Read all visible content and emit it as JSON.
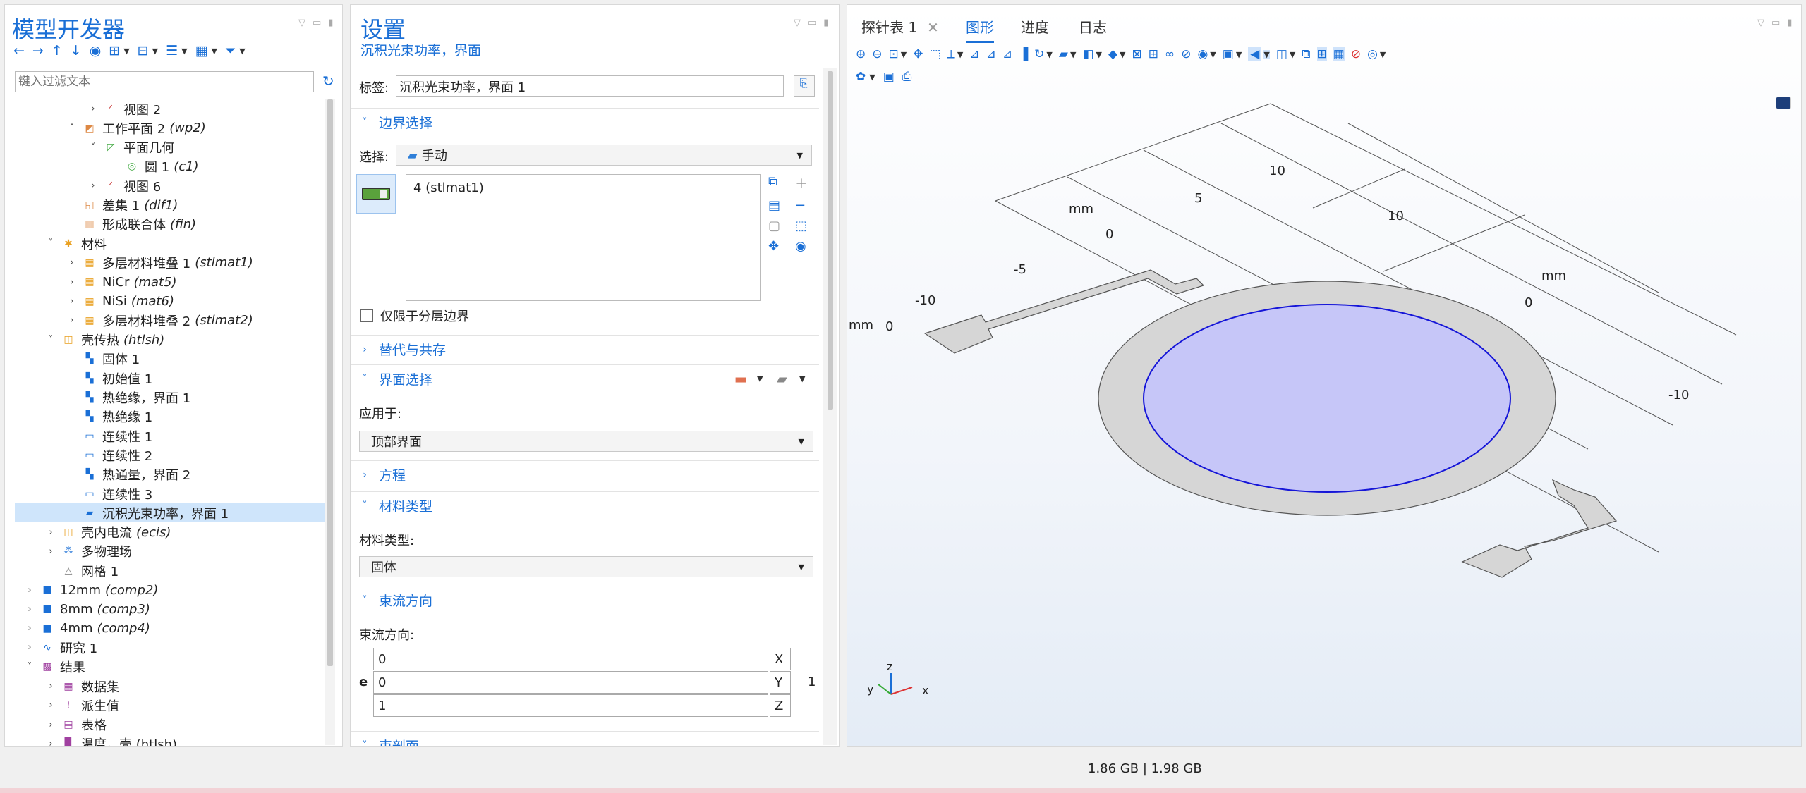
{
  "model_builder": {
    "title": "模型开发器",
    "filter_placeholder": "键入过滤文本",
    "tree": [
      {
        "label": "视图 2",
        "tag": "",
        "level": 4,
        "arrow": "›",
        "icon": "view"
      },
      {
        "label": "工作平面 2",
        "tag": "(wp2)",
        "level": 3,
        "arrow": "˅",
        "icon": "workplane"
      },
      {
        "label": "平面几何",
        "tag": "",
        "level": 4,
        "arrow": "˅",
        "icon": "geometry"
      },
      {
        "label": "圆 1",
        "tag": "(c1)",
        "level": 5,
        "arrow": "",
        "icon": "circle"
      },
      {
        "label": "视图 6",
        "tag": "",
        "level": 4,
        "arrow": "›",
        "icon": "view"
      },
      {
        "label": "差集 1",
        "tag": "(dif1)",
        "level": 3,
        "arrow": "",
        "icon": "difference"
      },
      {
        "label": "形成联合体",
        "tag": "(fin)",
        "level": 3,
        "arrow": "",
        "icon": "union"
      },
      {
        "label": "材料",
        "tag": "",
        "level": 2,
        "arrow": "˅",
        "icon": "materials"
      },
      {
        "label": "多层材料堆叠 1",
        "tag": "(stlmat1)",
        "level": 3,
        "arrow": "›",
        "icon": "material"
      },
      {
        "label": "NiCr",
        "tag": "(mat5)",
        "level": 3,
        "arrow": "›",
        "icon": "material"
      },
      {
        "label": "NiSi",
        "tag": "(mat6)",
        "level": 3,
        "arrow": "›",
        "icon": "material"
      },
      {
        "label": "多层材料堆叠 2",
        "tag": "(stlmat2)",
        "level": 3,
        "arrow": "›",
        "icon": "material"
      },
      {
        "label": "壳传热",
        "tag": "(htlsh)",
        "level": 2,
        "arrow": "˅",
        "icon": "physics"
      },
      {
        "label": "固体 1",
        "tag": "",
        "level": 3,
        "arrow": "",
        "icon": "node"
      },
      {
        "label": "初始值 1",
        "tag": "",
        "level": 3,
        "arrow": "",
        "icon": "node"
      },
      {
        "label": "热绝缘，界面 1",
        "tag": "",
        "level": 3,
        "arrow": "",
        "icon": "node"
      },
      {
        "label": "热绝缘 1",
        "tag": "",
        "level": 3,
        "arrow": "",
        "icon": "node"
      },
      {
        "label": "连续性 1",
        "tag": "",
        "level": 3,
        "arrow": "",
        "icon": "continuity"
      },
      {
        "label": "连续性 2",
        "tag": "",
        "level": 3,
        "arrow": "",
        "icon": "continuity"
      },
      {
        "label": "热通量，界面 2",
        "tag": "",
        "level": 3,
        "arrow": "",
        "icon": "node"
      },
      {
        "label": "连续性 3",
        "tag": "",
        "level": 3,
        "arrow": "",
        "icon": "continuity"
      },
      {
        "label": "沉积光束功率，界面 1",
        "tag": "",
        "level": 3,
        "arrow": "",
        "icon": "beam",
        "selected": true
      },
      {
        "label": "壳内电流",
        "tag": "(ecis)",
        "level": 2,
        "arrow": "›",
        "icon": "physics"
      },
      {
        "label": "多物理场",
        "tag": "",
        "level": 2,
        "arrow": "›",
        "icon": "multiphysics"
      },
      {
        "label": "网格 1",
        "tag": "",
        "level": 2,
        "arrow": "",
        "icon": "mesh"
      },
      {
        "label": "12mm",
        "tag": "(comp2)",
        "level": 1,
        "arrow": "›",
        "icon": "component"
      },
      {
        "label": "8mm",
        "tag": "(comp3)",
        "level": 1,
        "arrow": "›",
        "icon": "component"
      },
      {
        "label": "4mm",
        "tag": "(comp4)",
        "level": 1,
        "arrow": "›",
        "icon": "component"
      },
      {
        "label": "研究 1",
        "tag": "",
        "level": 1,
        "arrow": "›",
        "icon": "study"
      },
      {
        "label": "结果",
        "tag": "",
        "level": 1,
        "arrow": "˅",
        "icon": "results"
      },
      {
        "label": "数据集",
        "tag": "",
        "level": 2,
        "arrow": "›",
        "icon": "dataset"
      },
      {
        "label": "派生值",
        "tag": "",
        "level": 2,
        "arrow": "›",
        "icon": "derived"
      },
      {
        "label": "表格",
        "tag": "",
        "level": 2,
        "arrow": "›",
        "icon": "table"
      },
      {
        "label": "温度，壳 (htlsh)",
        "tag": "",
        "level": 2,
        "arrow": "›",
        "icon": "plot"
      }
    ]
  },
  "settings": {
    "title": "设置",
    "subtitle": "沉积光束功率，界面",
    "label_caption": "标签:",
    "label_value": "沉积光束功率，界面 1",
    "sections": {
      "boundary_selection": "边界选择",
      "override": "替代与共存",
      "interface_selection": "界面选择",
      "equation": "方程",
      "material_type": "材料类型",
      "beam_direction": "束流方向",
      "beam_profile": "束剖面"
    },
    "selection_caption": "选择:",
    "selection_value": "手动",
    "selection_list": [
      "4 (stlmat1)"
    ],
    "only_layer_boundary": "仅限于分层边界",
    "apply_to_caption": "应用于:",
    "apply_to_value": "顶部界面",
    "material_type_caption": "材料类型:",
    "material_type_value": "固体",
    "beam_dir_caption": "束流方向:",
    "beam_vector_symbol": "e",
    "beam_vector": [
      {
        "value": "0",
        "axis": "X"
      },
      {
        "value": "0",
        "axis": "Y"
      },
      {
        "value": "1",
        "axis": "Z"
      }
    ],
    "beam_unit": "1"
  },
  "graphics": {
    "tabs": [
      "探针表 1",
      "图形",
      "进度",
      "日志"
    ],
    "active_tab": "图形",
    "axis_labels": {
      "unit": "mm",
      "x_ticks": [
        "-10",
        "-5",
        "0",
        "5",
        "10"
      ],
      "y_ticks": [
        "10",
        "0",
        "-10"
      ],
      "z_tick": "0"
    },
    "triad": {
      "x": "x",
      "y": "y",
      "z": "z"
    }
  },
  "status": {
    "memory": "1.86 GB | 1.98 GB"
  },
  "colors": {
    "accent": "#1a6fd6",
    "selected_row": "#cfe5fb",
    "selection_fill": "#c6c6f8",
    "selection_edge": "#1515d8",
    "geometry_fill": "#d6d6d6"
  }
}
